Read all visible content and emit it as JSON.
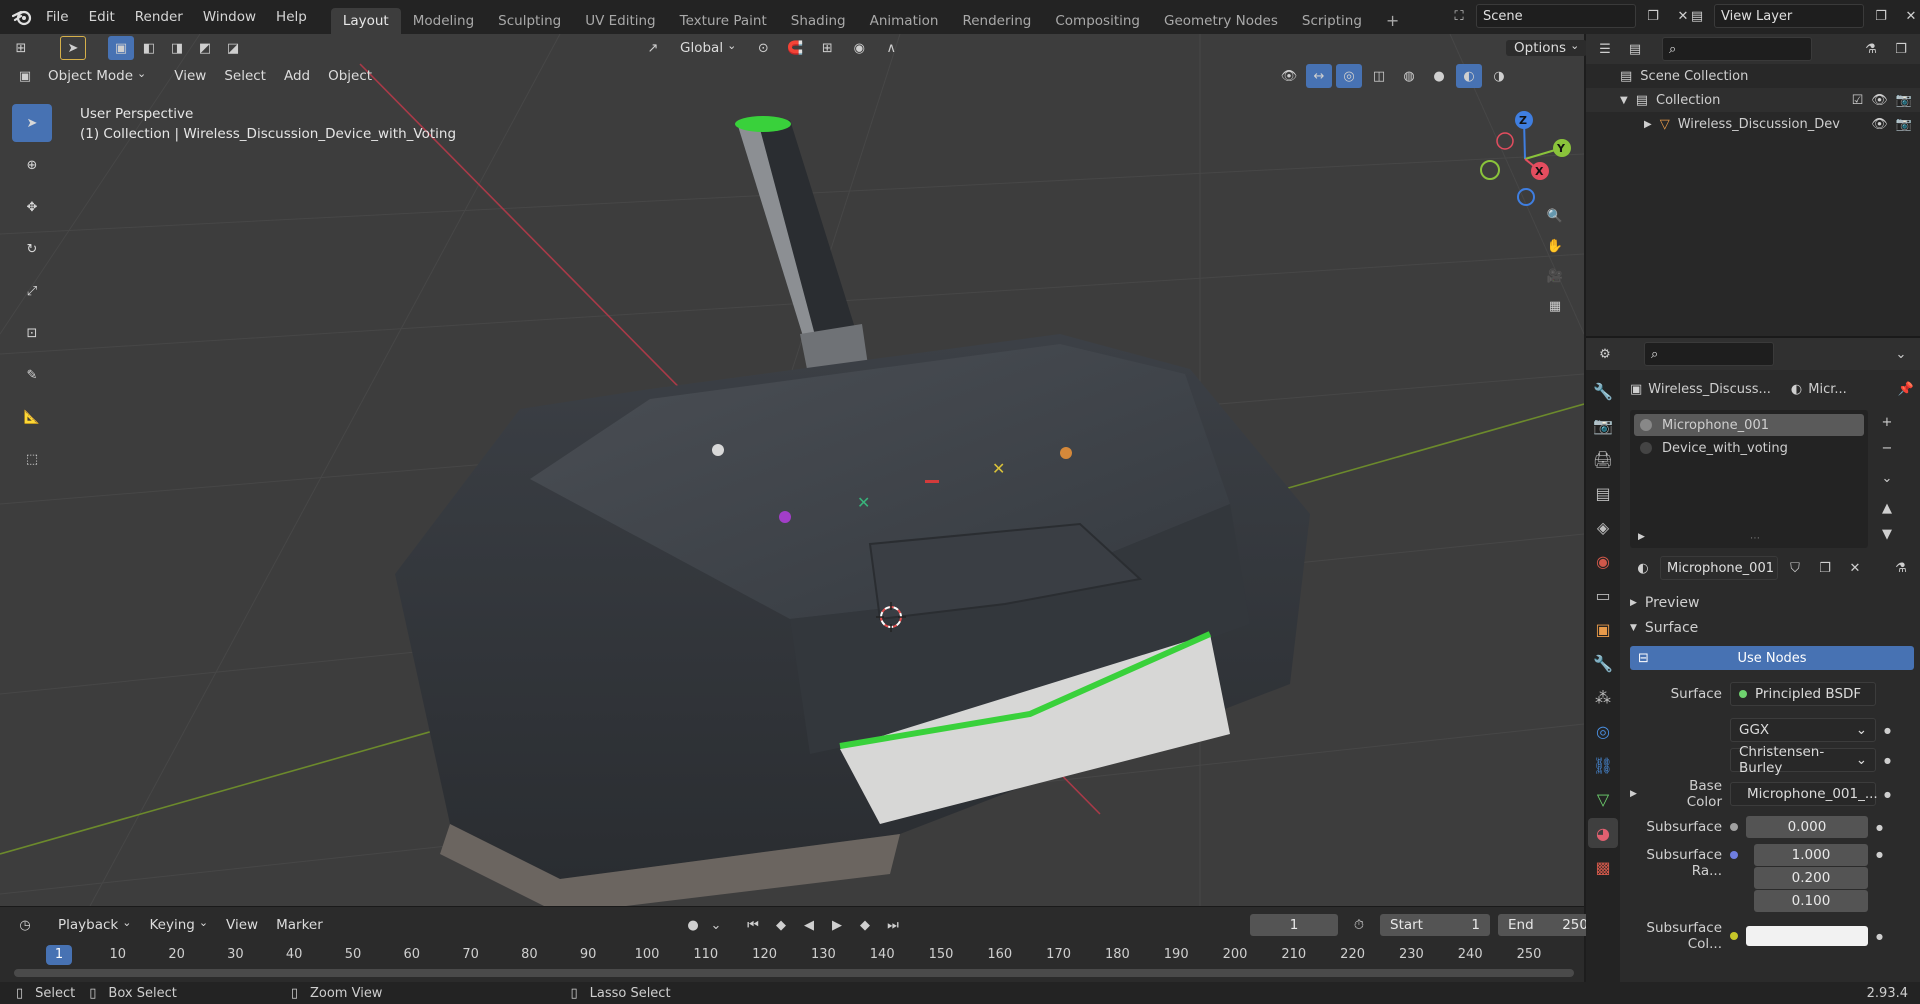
{
  "topbar": {
    "menus": [
      "File",
      "Edit",
      "Render",
      "Window",
      "Help"
    ],
    "workspaces": [
      "Layout",
      "Modeling",
      "Sculpting",
      "UV Editing",
      "Texture Paint",
      "Shading",
      "Animation",
      "Rendering",
      "Compositing",
      "Geometry Nodes",
      "Scripting"
    ],
    "active_workspace": "Layout",
    "scene_label": "Scene",
    "view_layer_label": "View Layer"
  },
  "viewport_header": {
    "transform_orientation": "Global",
    "options_label": "Options",
    "mode": "Object Mode",
    "menus": [
      "View",
      "Select",
      "Add",
      "Object"
    ]
  },
  "viewport": {
    "perspective_label": "User Perspective",
    "collection_label": "(1) Collection | Wireless_Discussion_Device_with_Voting",
    "gizmo_axes": {
      "x": "X",
      "y": "Y",
      "z": "Z"
    },
    "colors": {
      "x": "#e44d5f",
      "y": "#8ac33b",
      "z": "#3f7ee0",
      "accent_green": "#39d13b"
    }
  },
  "outliner": {
    "scene_collection": "Scene Collection",
    "collection": "Collection",
    "object": "Wireless_Discussion_Dev"
  },
  "properties": {
    "object_name": "Wireless_Discuss...",
    "material_tab": "Micr...",
    "slots": [
      "Microphone_001",
      "Device_with_voting"
    ],
    "active_slot": "Microphone_001",
    "material_name": "Microphone_001",
    "panel_preview": "Preview",
    "panel_surface": "Surface",
    "use_nodes": "Use Nodes",
    "surface_label": "Surface",
    "surface_value": "Principled BSDF",
    "distribution": "GGX",
    "subsurface_method": "Christensen-Burley",
    "base_color_label": "Base Color",
    "base_color_value": "Microphone_001_...",
    "subsurface_label": "Subsurface",
    "subsurface_value": "0.000",
    "subsurface_radius_label": "Subsurface Ra...",
    "subsurface_radius": [
      "1.000",
      "0.200",
      "0.100"
    ],
    "subsurface_color_label": "Subsurface Col..."
  },
  "timeline": {
    "menus": [
      "Playback",
      "Keying",
      "View",
      "Marker"
    ],
    "current_frame": "1",
    "start_label": "Start",
    "start_value": "1",
    "end_label": "End",
    "end_value": "250",
    "ticks": [
      "10",
      "20",
      "30",
      "40",
      "50",
      "60",
      "70",
      "80",
      "90",
      "100",
      "110",
      "120",
      "130",
      "140",
      "150",
      "160",
      "170",
      "180",
      "190",
      "200",
      "210",
      "220",
      "230",
      "240",
      "250"
    ],
    "playhead_label": "1"
  },
  "statusbar": {
    "select": "Select",
    "box_select": "Box Select",
    "zoom_view": "Zoom View",
    "lasso_select": "Lasso Select",
    "version": "2.93.4"
  }
}
